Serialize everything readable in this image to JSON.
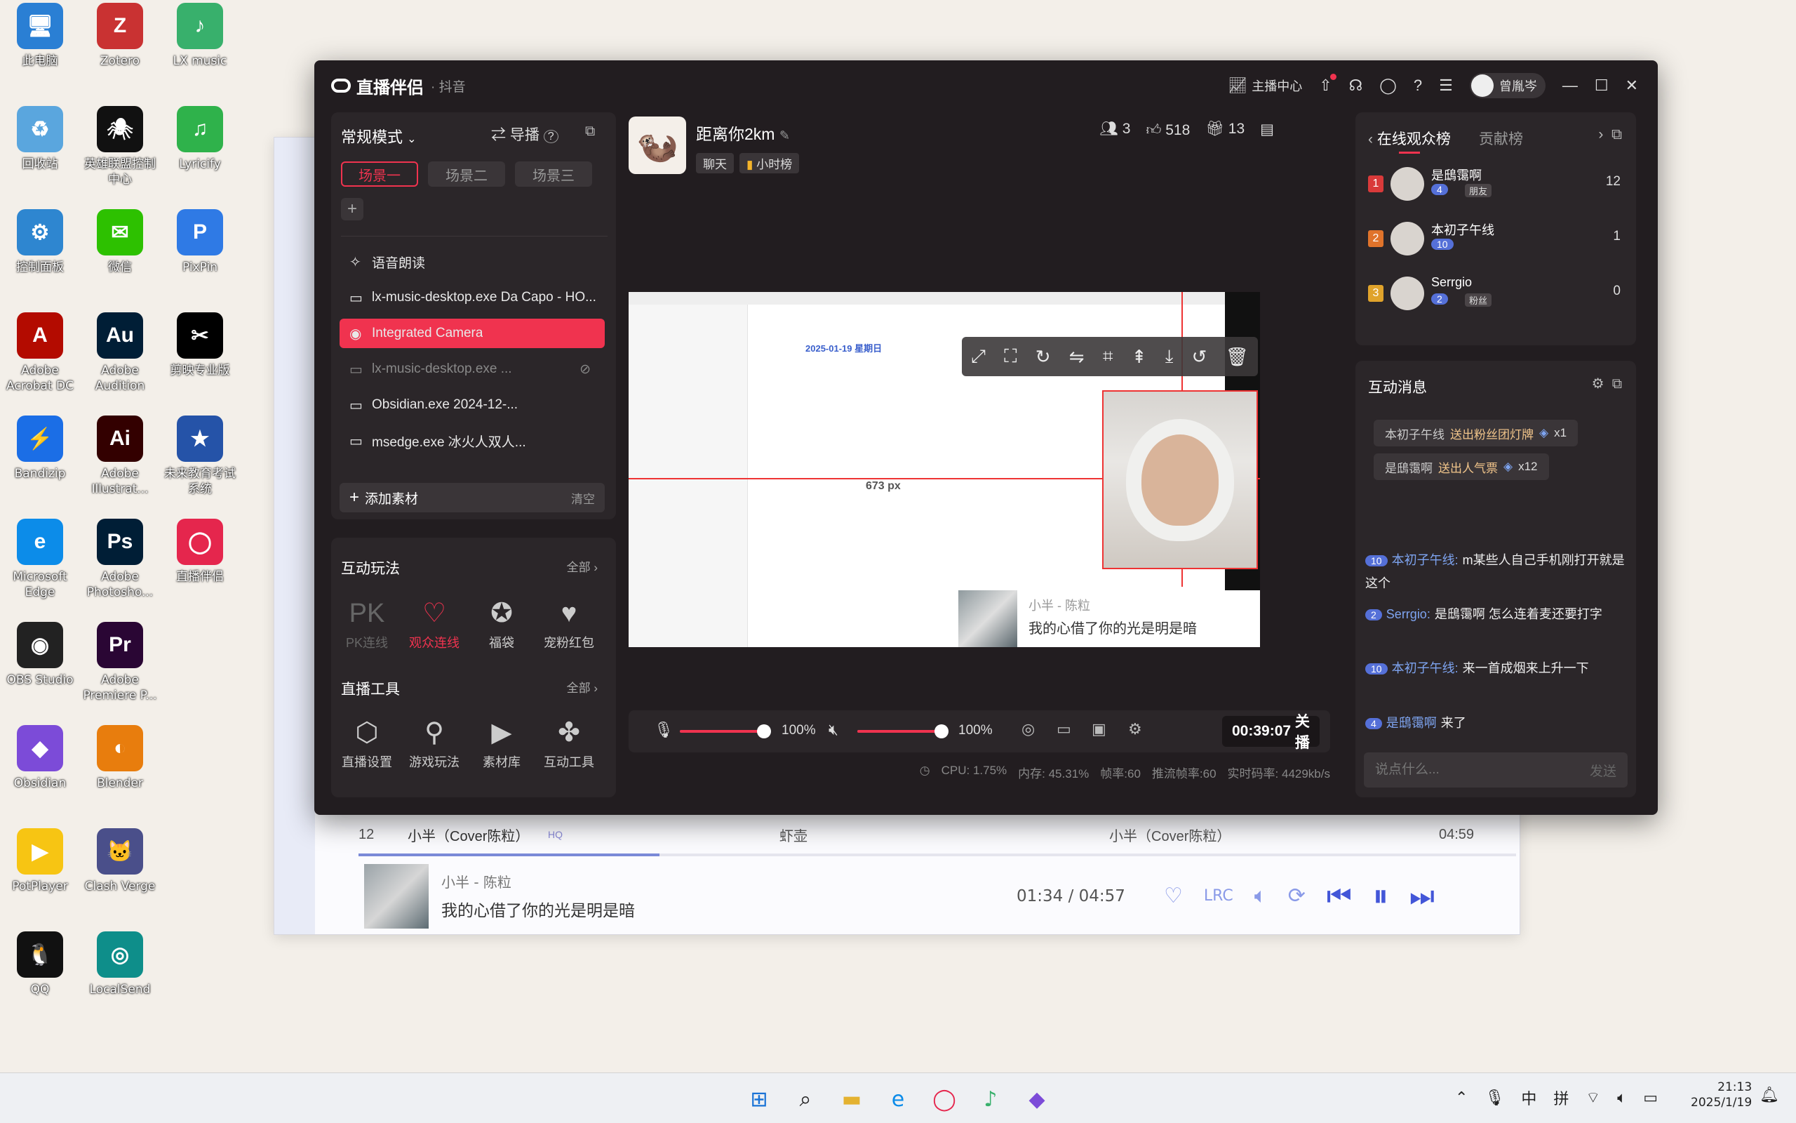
{
  "desktop": {
    "icons": [
      {
        "label": "此电脑",
        "glyph": "🖥",
        "color": "#2a7fd4"
      },
      {
        "label": "Zotero",
        "glyph": "Z",
        "color": "#c93232"
      },
      {
        "label": "LX music",
        "glyph": "♪",
        "color": "#38b06c"
      },
      {
        "label": "回收站",
        "glyph": "♻",
        "color": "#5aa6de"
      },
      {
        "label": "英雄联盟控制中心",
        "glyph": "🕷",
        "color": "#111"
      },
      {
        "label": "Lyricify",
        "glyph": "♫",
        "color": "#2fb24b"
      },
      {
        "label": "控制面板",
        "glyph": "⚙",
        "color": "#2e86d0"
      },
      {
        "label": "微信",
        "glyph": "✉",
        "color": "#2dc100"
      },
      {
        "label": "PixPin",
        "glyph": "P",
        "color": "#2f7ae5"
      },
      {
        "label": "Adobe Acrobat DC",
        "glyph": "A",
        "color": "#b30b00"
      },
      {
        "label": "Adobe Audition",
        "glyph": "Au",
        "color": "#001e36"
      },
      {
        "label": "剪映专业版",
        "glyph": "✂",
        "color": "#000"
      },
      {
        "label": "Bandizip",
        "glyph": "⚡",
        "color": "#1b6ee6"
      },
      {
        "label": "Adobe Illustrat...",
        "glyph": "Ai",
        "color": "#330000"
      },
      {
        "label": "未来教育考试系统",
        "glyph": "★",
        "color": "#2553a8"
      },
      {
        "label": "Microsoft Edge",
        "glyph": "e",
        "color": "#0c8ce9"
      },
      {
        "label": "Adobe Photosho...",
        "glyph": "Ps",
        "color": "#001e36"
      },
      {
        "label": "直播伴侣",
        "glyph": "◯",
        "color": "#e5264d"
      },
      {
        "label": "OBS Studio",
        "glyph": "◉",
        "color": "#222"
      },
      {
        "label": "Adobe Premiere P...",
        "glyph": "Pr",
        "color": "#2a0634"
      },
      {
        "label": "Obsidian",
        "glyph": "◆",
        "color": "#7c4bd8"
      },
      {
        "label": "Blender",
        "glyph": "◐",
        "color": "#e87d0d"
      },
      {
        "label": "PotPlayer",
        "glyph": "▶",
        "color": "#f7c513"
      },
      {
        "label": "Clash Verge",
        "glyph": "🐱",
        "color": "#4a4f8a"
      },
      {
        "label": "QQ",
        "glyph": "🐧",
        "color": "#111"
      },
      {
        "label": "LocalSend",
        "glyph": "◎",
        "color": "#0e8e8a"
      }
    ]
  },
  "music": {
    "row": {
      "num": "12",
      "title": "小半（Cover陈粒）",
      "hq": "HQ",
      "artist": "虾壶",
      "album": "小半（Cover陈粒）",
      "duration": "04:59"
    },
    "player": {
      "song": "小半 - 陈粒",
      "lyric": "我的心借了你的光是明是暗",
      "time": "01:34 / 04:57"
    }
  },
  "app": {
    "title": "直播伴侣",
    "platform": "· 抖音",
    "host_center": "主播中心",
    "user": "曾胤岑",
    "mode": "常规模式",
    "guide": "导播",
    "scenes": [
      "场景一",
      "场景二",
      "场景三"
    ],
    "sources": [
      {
        "label": "语音朗读",
        "icon": "✧"
      },
      {
        "label": "lx-music-desktop.exe Da Capo - HO...",
        "icon": "▭"
      },
      {
        "label": "Integrated Camera",
        "icon": "◉"
      },
      {
        "label": "lx-music-desktop.exe ...",
        "icon": "▭"
      },
      {
        "label": "Obsidian.exe 2024-12-...",
        "icon": "▭"
      },
      {
        "label": "msedge.exe 冰火人双人...",
        "icon": "▭"
      }
    ],
    "add_source": "添加素材",
    "clear": "清空",
    "interactive": {
      "title": "互动玩法",
      "all": "全部",
      "items": [
        {
          "label": "PK连线",
          "icon": "PK"
        },
        {
          "label": "观众连线",
          "icon": "♡"
        },
        {
          "label": "福袋",
          "icon": "✪"
        },
        {
          "label": "宠粉红包",
          "icon": "♥"
        }
      ]
    },
    "tools": {
      "title": "直播工具",
      "all": "全部",
      "items": [
        {
          "label": "直播设置",
          "icon": "⬡"
        },
        {
          "label": "游戏玩法",
          "icon": "⚲"
        },
        {
          "label": "素材库",
          "icon": "▶"
        },
        {
          "label": "互动工具",
          "icon": "✤"
        }
      ]
    },
    "room": {
      "name": "距离你2km",
      "tag_chat": "聊天",
      "tag_rank": "小时榜",
      "viewers": "3",
      "likes": "518",
      "gifts": "13"
    },
    "preview": {
      "date": "2025-01-19 星期日",
      "distance_label": "673 px",
      "song_title": "小半 - 陈粒",
      "lyric": "我的心借了你的光是明是暗"
    },
    "controls": {
      "mic_level": "100%",
      "mic_fraction": 0.92,
      "speaker_level": "100%",
      "speaker_fraction": 0.92,
      "timer": "00:39:07",
      "end": "关播"
    },
    "stats": {
      "cpu": "CPU: 1.75%",
      "mem": "内存: 45.31%",
      "fps": "帧率:60",
      "push_fps": "推流帧率:60",
      "bitrate": "实时码率: 4429kb/s"
    },
    "viewers_panel": {
      "tab_online": "在线观众榜",
      "tab_contrib": "贡献榜",
      "list": [
        {
          "rank": "1",
          "name": "是鴟霭啊",
          "level": "4",
          "badge": "朋友",
          "score": "12",
          "rank_color": "#d93a3a"
        },
        {
          "rank": "2",
          "name": "本初子午线",
          "level": "10",
          "badge": "",
          "score": "1",
          "rank_color": "#e0732b"
        },
        {
          "rank": "3",
          "name": "Serrgio",
          "level": "2",
          "badge": "粉丝",
          "score": "0",
          "rank_color": "#e0a32b"
        }
      ]
    },
    "messages_panel": {
      "title": "互动消息",
      "gifts": [
        {
          "user": "本初子午线",
          "action": "送出粉丝团灯牌",
          "count": "x1"
        },
        {
          "user": "是鴟霭啊",
          "action": "送出人气票",
          "count": "x12"
        }
      ],
      "chats": [
        {
          "level": "10",
          "user": "本初子午线:",
          "text": "m某些人自己手机刚打开就是这个"
        },
        {
          "level": "2",
          "user": "Serrgio:",
          "text": "是鴟霭啊 怎么连着麦还要打字"
        },
        {
          "level": "10",
          "user": "本初子午线:",
          "text": "来一首成烟来上升一下"
        },
        {
          "level": "4",
          "user": "是鴟霭啊",
          "text": "来了"
        }
      ],
      "input_placeholder": "说点什么...",
      "send": "发送"
    }
  },
  "taskbar": {
    "ime_zh": "中",
    "ime_pin": "拼",
    "time": "21:13",
    "date": "2025/1/19"
  },
  "colors": {
    "accent": "#f0334f",
    "panel": "#2b2629",
    "bg": "#221d20"
  }
}
